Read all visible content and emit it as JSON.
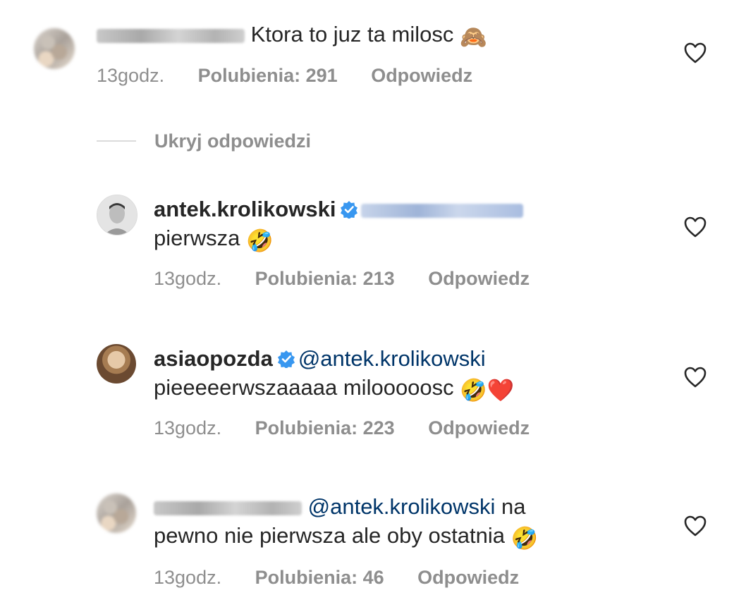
{
  "comments": [
    {
      "username": "",
      "mention": "",
      "text": "Ktora to juz ta milosc",
      "emoji": "🙈",
      "time": "13godz.",
      "likes": "Polubienia: 291",
      "reply": "Odpowiedz"
    },
    {
      "username": "antek.krolikowski",
      "verified": true,
      "mention": "",
      "text": "pierwsza",
      "emoji": "🤣",
      "time": "13godz.",
      "likes": "Polubienia: 213",
      "reply": "Odpowiedz"
    },
    {
      "username": "asiaopozda",
      "verified": true,
      "mention": "@antek.krolikowski",
      "text": "pieeeeerwszaaaaa milooooosc",
      "emoji": "🤣",
      "emoji2": "❤️",
      "time": "13godz.",
      "likes": "Polubienia: 223",
      "reply": "Odpowiedz"
    },
    {
      "username": "",
      "mention": "@antek.krolikowski",
      "text_line1": "na",
      "text_line2": "pewno nie pierwsza ale oby ostatnia",
      "emoji": "🤣",
      "time": "13godz.",
      "likes": "Polubienia: 46",
      "reply": "Odpowiedz"
    }
  ],
  "hide_replies": "Ukryj odpowiedzi",
  "colors": {
    "text": "#262626",
    "meta": "#8e8e8e",
    "mention": "#003569",
    "verified": "#3897f0"
  },
  "icons": [
    "heart-outline-icon",
    "verified-badge-icon"
  ]
}
